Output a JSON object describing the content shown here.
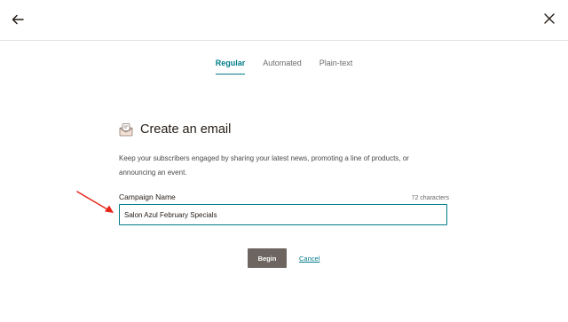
{
  "tabs": [
    {
      "label": "Regular",
      "active": true
    },
    {
      "label": "Automated",
      "active": false
    },
    {
      "label": "Plain-text",
      "active": false
    }
  ],
  "heading": {
    "title": "Create an email",
    "icon": "email-icon"
  },
  "description": "Keep your subscribers engaged by sharing your latest news, promoting a line of products, or announcing an event.",
  "campaign_field": {
    "label": "Campaign Name",
    "char_count": "72 characters",
    "value": "Salon Azul February Specials"
  },
  "actions": {
    "begin_label": "Begin",
    "cancel_label": "Cancel"
  },
  "colors": {
    "accent": "#007c89",
    "begin_button": "#6e6560",
    "annotation_arrow": "#e8261a"
  }
}
